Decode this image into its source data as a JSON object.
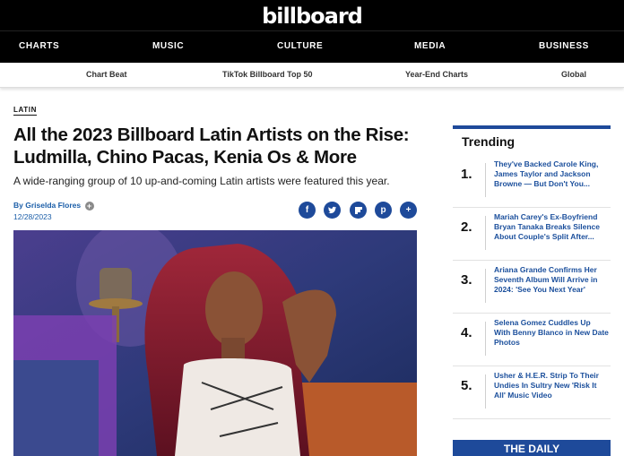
{
  "site": {
    "logo": "billboard"
  },
  "main_nav": [
    "CHARTS",
    "MUSIC",
    "CULTURE",
    "MEDIA",
    "BUSINESS"
  ],
  "sub_nav": [
    "Chart Beat",
    "TikTok Billboard Top 50",
    "Year-End Charts",
    "Global"
  ],
  "article": {
    "category": "LATIN",
    "headline": "All the 2023 Billboard Latin Artists on the Rise: Ludmilla, Chino Pacas, Kenia Os & More",
    "dek": "A wide-ranging group of 10 up-and-coming Latin artists were featured this year.",
    "byline": "By Griselda Flores",
    "date": "12/28/2023"
  },
  "share_icons": [
    "facebook-icon",
    "twitter-icon",
    "flipboard-icon",
    "pinterest-icon",
    "more-icon"
  ],
  "trending": {
    "title": "Trending",
    "items": [
      {
        "num": "1.",
        "text": "They've Backed Carole King, James Taylor and Jackson Browne — But Don't You..."
      },
      {
        "num": "2.",
        "text": "Mariah Carey's Ex-Boyfriend Bryan Tanaka Breaks Silence About Couple's Split After..."
      },
      {
        "num": "3.",
        "text": "Ariana Grande Confirms Her Seventh Album Will Arrive in 2024: 'See You Next Year'"
      },
      {
        "num": "4.",
        "text": "Selena Gomez Cuddles Up With Benny Blanco in New Date Photos"
      },
      {
        "num": "5.",
        "text": "Usher & H.E.R. Strip To Their Undies In Sultry New 'Risk It All' Music Video"
      }
    ]
  },
  "daily": {
    "label": "THE DAILY"
  },
  "colors": {
    "brand_blue": "#1e4a9a",
    "link_blue": "#1b4f9c",
    "header_bg": "#000000"
  }
}
